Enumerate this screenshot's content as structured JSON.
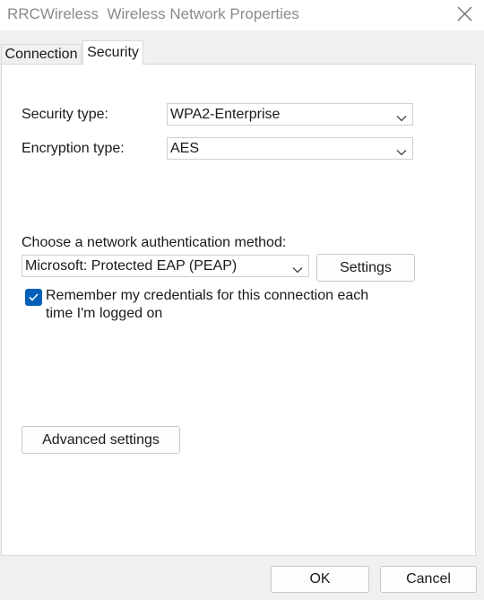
{
  "window": {
    "title": "RRCWireless  Wireless Network Properties",
    "close_icon": "close-icon"
  },
  "tabs": [
    {
      "label": "Connection",
      "selected": false
    },
    {
      "label": "Security",
      "selected": true
    }
  ],
  "security": {
    "security_type_label": "Security type:",
    "security_type_value": "WPA2-Enterprise",
    "encryption_type_label": "Encryption type:",
    "encryption_type_value": "AES",
    "auth_method_label": "Choose a network authentication method:",
    "auth_method_value": "Microsoft: Protected EAP (PEAP)",
    "settings_button": "Settings",
    "remember_credentials": {
      "checked": true,
      "label": "Remember my credentials for this connection each time I'm logged on"
    },
    "advanced_settings_button": "Advanced settings"
  },
  "footer": {
    "ok_button": "OK",
    "cancel_button": "Cancel"
  },
  "colors": {
    "accent": "#005fb8",
    "title_text": "#8a8a8a"
  }
}
